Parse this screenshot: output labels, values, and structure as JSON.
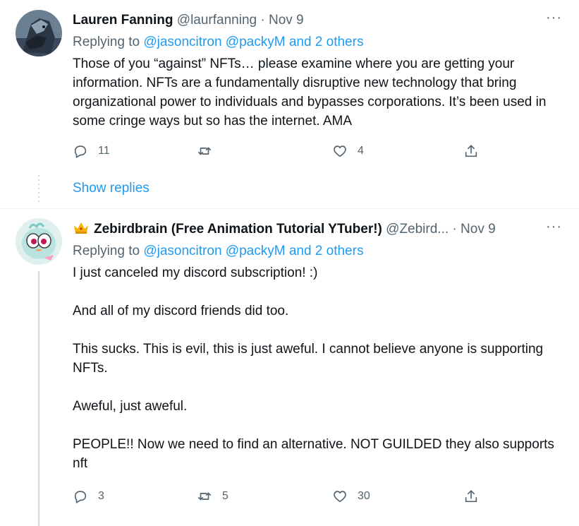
{
  "tweets": [
    {
      "display_name": "Lauren Fanning",
      "handle": "@laurfanning",
      "separator": "·",
      "time": "Nov 9",
      "more": "···",
      "replying_prefix": "Replying to",
      "replying_to": "@jasoncitron @packyM and 2 others",
      "paragraphs": [
        "Those of you “against” NFTs… please examine where you are getting your information. NFTs are a fundamentally disruptive new technology that bring organizational power to individuals and bypasses corporations. It’s been used in some cringe ways but so has the internet. AMA"
      ],
      "reply_count": "11",
      "retweet_count": "",
      "like_count": "4",
      "show_replies": "Show replies"
    },
    {
      "display_name": "Zebirdbrain (Free Animation Tutorial YTuber!)",
      "handle": "@Zebird...",
      "separator": "·",
      "time": "Nov 9",
      "more": "···",
      "replying_prefix": "Replying to",
      "replying_to": "@jasoncitron @packyM and 2 others",
      "paragraphs": [
        "I just canceled my discord subscription! :)",
        "And all of my discord friends did too.",
        "This sucks. This is evil, this is just aweful. I cannot believe anyone is supporting NFTs.",
        "Aweful, just aweful.",
        "PEOPLE!! Now we need to find an alternative. NOT GUILDED they also supports nft"
      ],
      "reply_count": "3",
      "retweet_count": "5",
      "like_count": "30"
    }
  ],
  "colors": {
    "link": "#1d9bf0",
    "muted": "#536471",
    "text": "#0f1419",
    "divider": "#eff3f4",
    "thread_line": "#cfd9de"
  },
  "icons": {
    "reply": "reply-icon",
    "retweet": "retweet-icon",
    "like": "heart-icon",
    "share": "share-icon",
    "crown": "crown-icon"
  }
}
